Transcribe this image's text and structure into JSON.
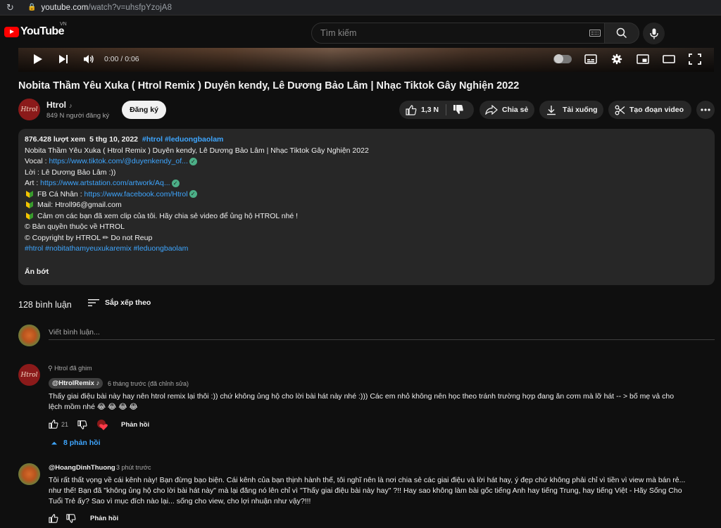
{
  "browser": {
    "host": "youtube.com",
    "path": "/watch?v=uhsfpYzojA8"
  },
  "header": {
    "logo_text": "YouTube",
    "country_code": "VN",
    "search_placeholder": "Tìm kiếm"
  },
  "player": {
    "time": "0:00 / 0:06"
  },
  "video": {
    "title": "Nobita Thầm Yêu Xuka ( Htrol Remix ) Duyên kendy, Lê Dương Bảo Lâm | Nhạc Tiktok Gây Nghiện 2022",
    "channel_name": "Htrol",
    "channel_note": "♪",
    "channel_avatar_text": "Htrol",
    "subscribers": "849 N người đăng ký",
    "subscribe_label": "Đăng ký",
    "likes": "1,3 N",
    "share_label": "Chia sẻ",
    "download_label": "Tải xuống",
    "clip_label": "Tạo đoạn video"
  },
  "description": {
    "views": "876.428 lượt xem",
    "date": "5 thg 10, 2022",
    "tags": "#htrol #leduongbaolam",
    "line1": "Nobita Thầm Yêu Xuka ( Htrol Remix ) Duyên kendy, Lê Dương Bảo Lâm | Nhạc Tiktok Gây Nghiện 2022",
    "vocal_label": "Vocal : ",
    "vocal_link": "https://www.tiktok.com/@duyenkendy_of...",
    "loi_line": "Lời : Lê Dương Bảo Lâm :))",
    "art_label": "Art : ",
    "art_link": "https://www.artstation.com/artwork/Aq...",
    "fb_label": "FB Cá Nhân : ",
    "fb_link": "https://www.facebook.com/Htrol",
    "mail_line": "Mail: Htroll96@gmail.com",
    "thanks_line": "Cảm ơn các bạn đã xem clip của tôi. Hãy chia sẻ video để ủng hộ HTROL nhé !",
    "copyright_vi": "© Bản quyền thuộc về HTROL",
    "copyright_en": "© Copyright by HTROL  ✏ Do not Reup",
    "hashtags": "#htrol #nobitathamyeuxukaremix #leduongbaolam",
    "collapse_label": "Ẩn bớt"
  },
  "comments": {
    "count_label": "128 bình luận",
    "sort_label": "Sắp xếp theo",
    "input_placeholder": "Viết bình luận...",
    "items": [
      {
        "pinned_label": "Htrol đã ghim",
        "author": "@HtrolRemix ♪",
        "time": "6 tháng trước (đã chỉnh sửa)",
        "text1": "Thấy giai điệu bài này hay nên htrol remix lại thôi :)) chứ không ủng hộ cho lời bài hát này nhé :))) Các em nhỏ không nên học theo tránh trường hợp đang ăn cơm mà lỡ hát -- > bố mẹ  vả cho",
        "text2": "lệch mồm nhé 😂 😂 😂 😂",
        "likes": "21",
        "reply_label": "Phản hồi",
        "replies_label": "8 phản hồi"
      },
      {
        "author": "@HoangDinhThuong",
        "time": "3 phút trước",
        "text1": "Tôi rất thất vọng về cái kênh này! Bạn đừng bạo biện. Cái kênh của bạn thịnh hành thế, tôi nghĩ nên là nơi chia sẻ các giai điệu và lời hát hay, ý đẹp chứ không phải chỉ vì tiền vì view mà bán rẻ...",
        "text2": "như thế! Bạn đã \"không ủng hộ cho lời bài hát này\" mà lại đăng nó lên chỉ vì \"Thấy giai điệu bài này hay\" ?!! Hay sao không làm bài gốc tiếng Anh hay tiếng Trung, hay tiếng Việt - Hãy Sống Cho",
        "text3": "Tuổi Trẻ ấy? Sao vì mục đích nào lại... sống cho view, cho lợi nhuận như vậy?!!!",
        "reply_label": "Phản hồi"
      }
    ]
  }
}
